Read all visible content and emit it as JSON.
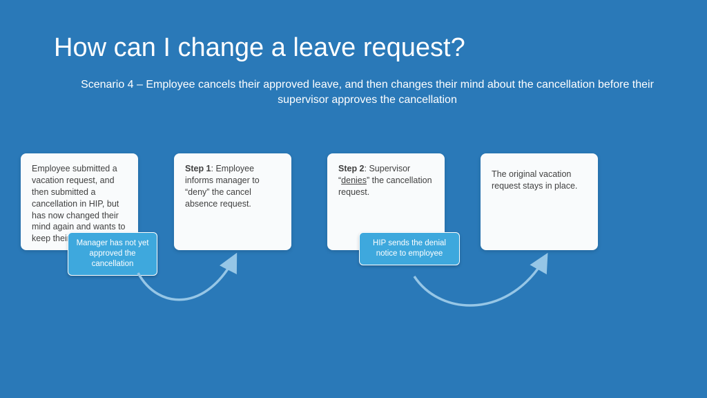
{
  "title": "How can I change a leave request?",
  "subtitle": "Scenario 4 – Employee cancels their approved leave, and then changes their mind about the cancellation before their supervisor approves the cancellation",
  "cards": {
    "c1": "Employee submitted a vacation request, and then submitted a cancellation in HIP, but has now changed their mind again and wants to keep their vacation.",
    "c2_prefix": "Step 1",
    "c2_rest": ": Employee informs manager to “deny” the cancel absence request.",
    "c3_prefix": "Step 2",
    "c3_a": ": Supervisor “",
    "c3_denies": "denies",
    "c3_b": "” the cancellation request.",
    "c4": "The original vacation request stays in place."
  },
  "subcards": {
    "s1": "Manager has not yet approved the cancellation",
    "s2": "HIP sends the denial notice to employee"
  }
}
